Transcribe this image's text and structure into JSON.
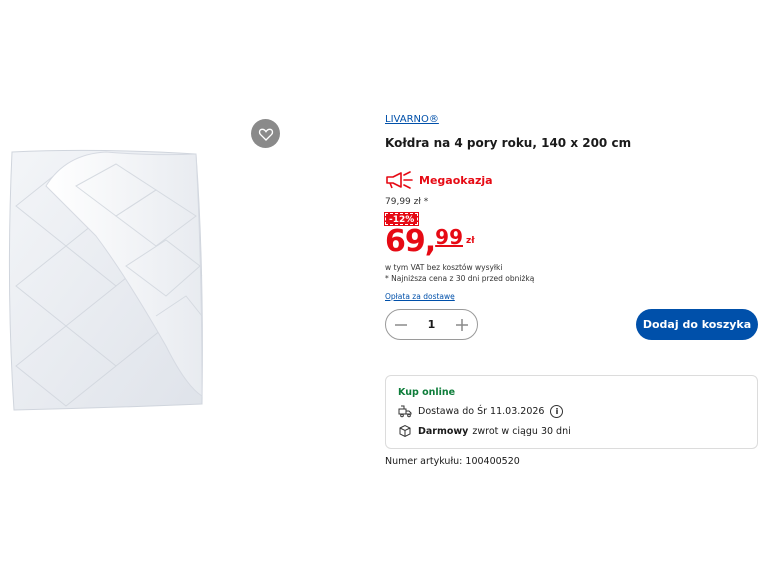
{
  "product": {
    "brand": "LIVARNO®",
    "title": "Kołdra na 4 pory roku, 140 x 200 cm",
    "badge_label": "Megaokazja",
    "old_price": "79,99 zł *",
    "discount": "-12%",
    "price_int": "69,",
    "price_dec": "99",
    "currency": "zł",
    "vat_note": "w tym VAT bez kosztów wysyłki",
    "lowest_price_note": "* Najniższa cena z 30 dni przed obniżką",
    "shipping_link": "Opłata za dostawę",
    "quantity": "1",
    "add_to_cart": "Dodaj do koszyka",
    "article_number": "Numer artykułu: 100400520"
  },
  "online": {
    "title": "Kup online",
    "delivery": "Dostawa do Śr 11.03.2026",
    "info_glyph": "i",
    "return_bold": "Darmowy",
    "return_text": "zwrot w ciągu 30 dni"
  },
  "icons": {
    "wishlist": "heart-icon",
    "megaphone": "megaphone-icon",
    "delivery": "delivery-truck-icon",
    "return": "return-box-icon",
    "info": "info-icon",
    "minus": "minus-icon",
    "plus": "plus-icon"
  },
  "colors": {
    "brand_blue": "#0050aa",
    "sale_red": "#e60a14",
    "online_green": "#0e7d3a"
  }
}
